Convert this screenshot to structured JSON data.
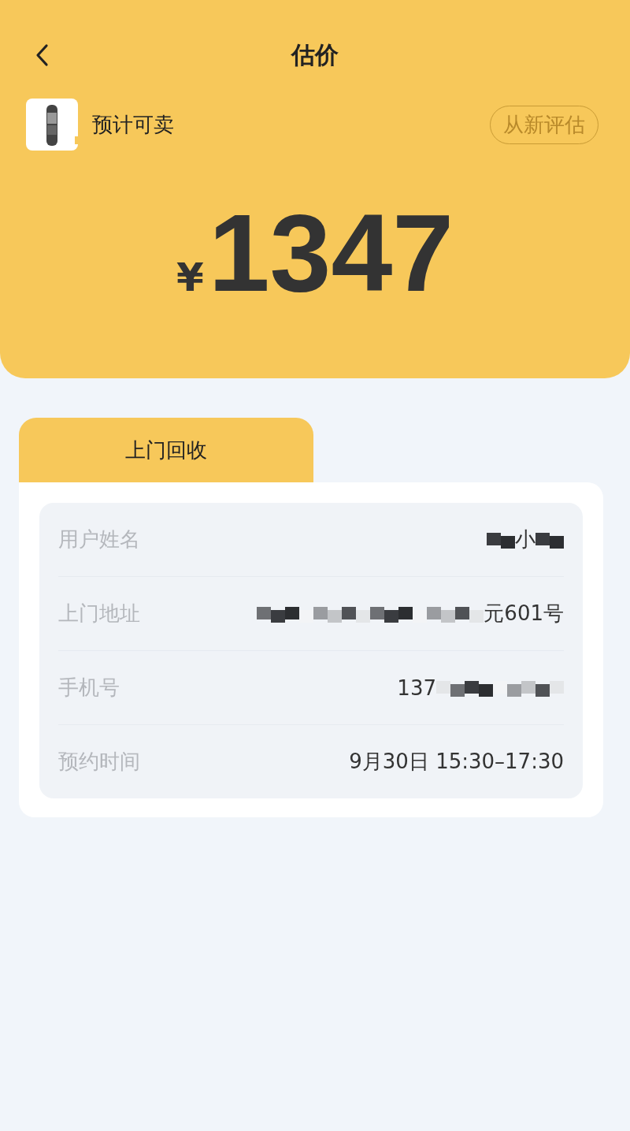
{
  "header": {
    "title": "估价",
    "product_label": "预计可卖",
    "reassess_button": "从新评估",
    "currency": "¥",
    "price": "1347"
  },
  "tabs": [
    {
      "label": "上门回收",
      "selected": true
    }
  ],
  "details": [
    {
      "label": "用户姓名",
      "value": [
        {
          "kind": "mosaic"
        },
        {
          "kind": "text",
          "text": "小"
        },
        {
          "kind": "mosaic"
        }
      ]
    },
    {
      "label": "上门地址",
      "value": [
        {
          "kind": "mosaic"
        },
        {
          "kind": "text",
          "text": "元601号"
        }
      ]
    },
    {
      "label": "手机号",
      "value": [
        {
          "kind": "text",
          "text": "137"
        },
        {
          "kind": "mosaic"
        }
      ]
    },
    {
      "label": "预约时间",
      "value": [
        {
          "kind": "text",
          "text": "9月30日 15:30–17:30"
        }
      ]
    }
  ]
}
